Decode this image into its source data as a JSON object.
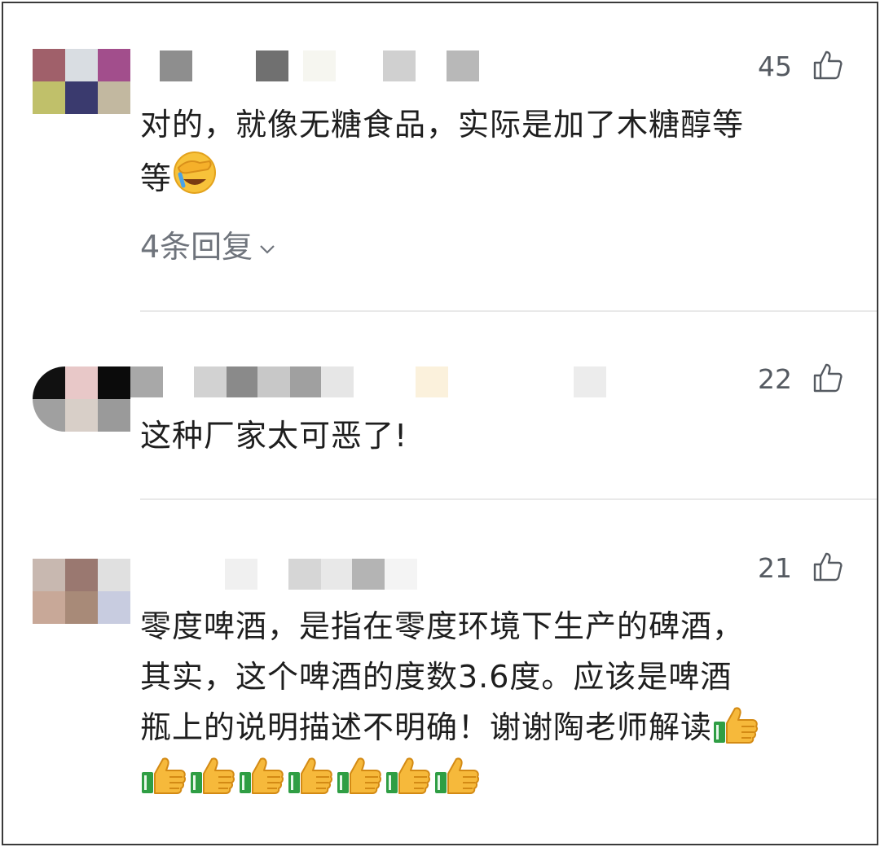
{
  "comments": [
    {
      "likes": "45",
      "text_line1": "对的，就像无糖食品，实际是加了木糖醇等",
      "text_line2": "等",
      "emoji": "facepalm-laugh-emoji",
      "replies_label": "4条回复",
      "avatar_colors": [
        "#a0606a",
        "#d9dde2",
        "#a24e8c",
        "#c0c06a",
        "#3a3a6e",
        "#c2b8a0"
      ]
    },
    {
      "likes": "22",
      "text": "这种厂家太可恶了!",
      "avatar_colors": [
        "#111111",
        "#e8c8c8",
        "#0b0b0b",
        "#a0a0a0",
        "#d8cfc8",
        "#9a9a9a"
      ]
    },
    {
      "likes": "21",
      "text_line1": "零度啤酒，是指在零度环境下生产的碑酒，",
      "text_line2": "其实，这个啤酒的度数3.6度。应该是啤酒",
      "text_line3": "瓶上的说明描述不明确！谢谢陶老师解读",
      "emoji": "thumbs-up-emoji",
      "avatar_colors": [
        "#c8b8b0",
        "#9a7870",
        "#e0e0e0",
        "#c8a898",
        "#a88a78",
        "#c8cce0"
      ]
    }
  ],
  "icons": {
    "like": "thumbs-up-outline-icon",
    "expand": "chevron-down-icon"
  },
  "colors": {
    "text": "#1e1e1e",
    "muted": "#6f747c",
    "divider": "#e9e9e9"
  }
}
